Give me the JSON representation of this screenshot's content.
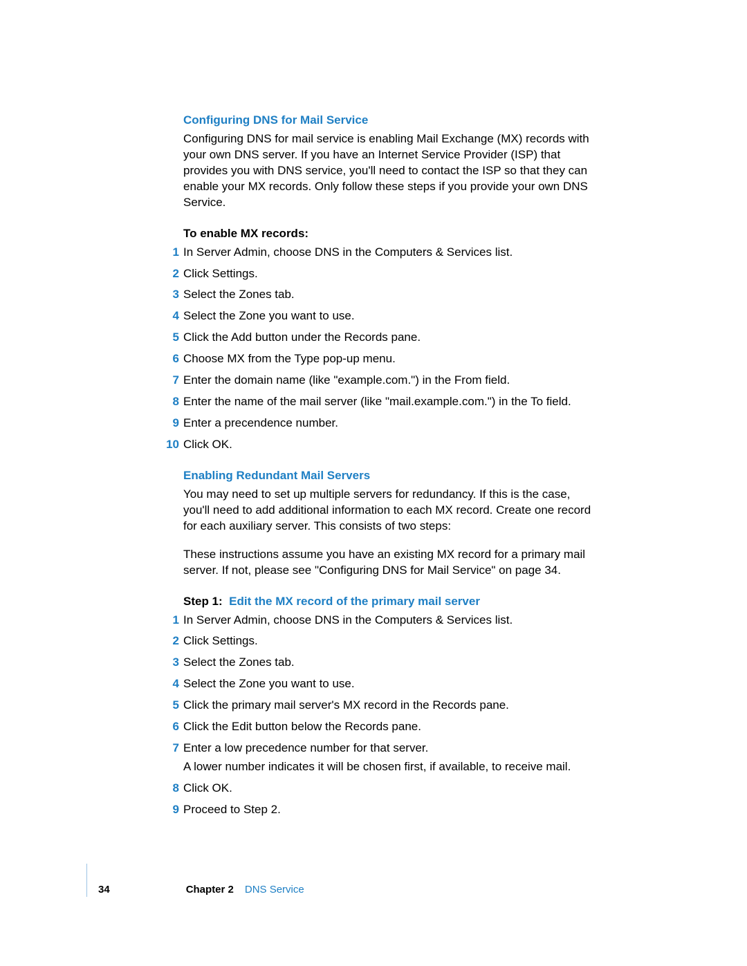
{
  "section1": {
    "heading": "Configuring DNS for Mail Service",
    "paragraph": "Configuring DNS for mail service is enabling Mail Exchange (MX) records with your own DNS server. If you have an Internet Service Provider (ISP) that provides you with DNS service, you'll need to contact the ISP so that they can enable your MX records. Only follow these steps if you provide your own DNS Service."
  },
  "enable": {
    "heading": "To enable MX records:",
    "steps": [
      "In Server Admin, choose DNS in the Computers & Services list.",
      "Click Settings.",
      "Select the Zones tab.",
      "Select the Zone you want to use.",
      "Click the Add button under the Records pane.",
      "Choose MX from the Type pop-up menu.",
      "Enter the domain name (like \"example.com.\") in the From field.",
      "Enter the name of the mail server (like \"mail.example.com.\") in the To field.",
      "Enter a precendence number.",
      "Click OK."
    ]
  },
  "section2": {
    "heading": "Enabling Redundant Mail Servers",
    "paragraph1": "You may need to set up multiple servers for redundancy. If this is the case, you'll need to add additional information to each MX record. Create one record for each auxiliary server. This consists of two steps:",
    "paragraph2": "These instructions assume you have an existing MX record for a primary mail server. If not, please see \"Configuring DNS for Mail Service\" on page 34."
  },
  "step1": {
    "label": "Step 1:",
    "heading": "Edit the MX record of the primary mail server",
    "steps": [
      {
        "text": "In Server Admin, choose DNS in the Computers & Services list."
      },
      {
        "text": "Click Settings."
      },
      {
        "text": "Select the Zones tab."
      },
      {
        "text": "Select the Zone you want to use."
      },
      {
        "text": "Click the primary mail server's MX record in the Records pane."
      },
      {
        "text": "Click the Edit button below the Records pane."
      },
      {
        "text": "Enter a low precedence number for that server.",
        "note": "A lower number indicates it will be chosen first, if available, to receive mail."
      },
      {
        "text": "Click OK."
      },
      {
        "text": "Proceed to Step 2."
      }
    ]
  },
  "footer": {
    "page": "34",
    "chapter": "Chapter 2",
    "service": "DNS Service"
  }
}
